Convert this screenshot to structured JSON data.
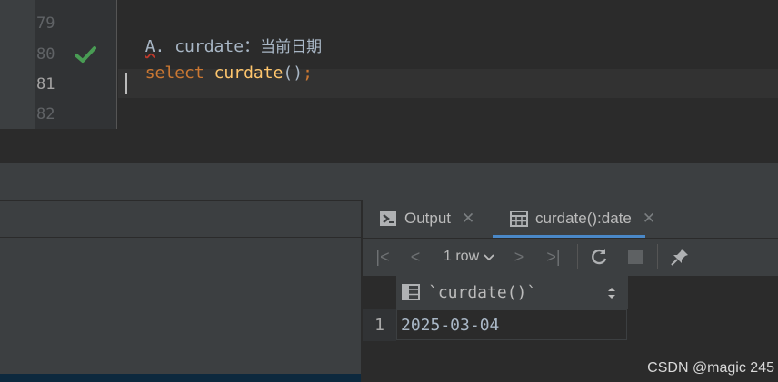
{
  "editor": {
    "line_numbers": [
      "79",
      "80",
      "81",
      "82"
    ],
    "comment_line": {
      "prefix": "A",
      "rest": ". curdate：",
      "cn": "当前日期"
    },
    "code_line": {
      "keyword": "select",
      "function": "curdate",
      "parens": "()",
      "semicolon": ";"
    }
  },
  "output_panel": {
    "tabs": [
      {
        "label": "Output",
        "icon": "console-output-icon"
      },
      {
        "label": "curdate():date",
        "icon": "table-grid-icon"
      }
    ],
    "toolbar": {
      "rows_label": "1 row"
    },
    "grid": {
      "column_header": "`curdate()`",
      "rows": [
        {
          "row_number": "1",
          "value": "2025-03-04"
        }
      ]
    }
  },
  "watermark": "CSDN @magic 245",
  "colors": {
    "accent": "#4a88c7",
    "success_check": "#499c54",
    "keyword": "#cc7832",
    "function": "#ffc66d"
  }
}
